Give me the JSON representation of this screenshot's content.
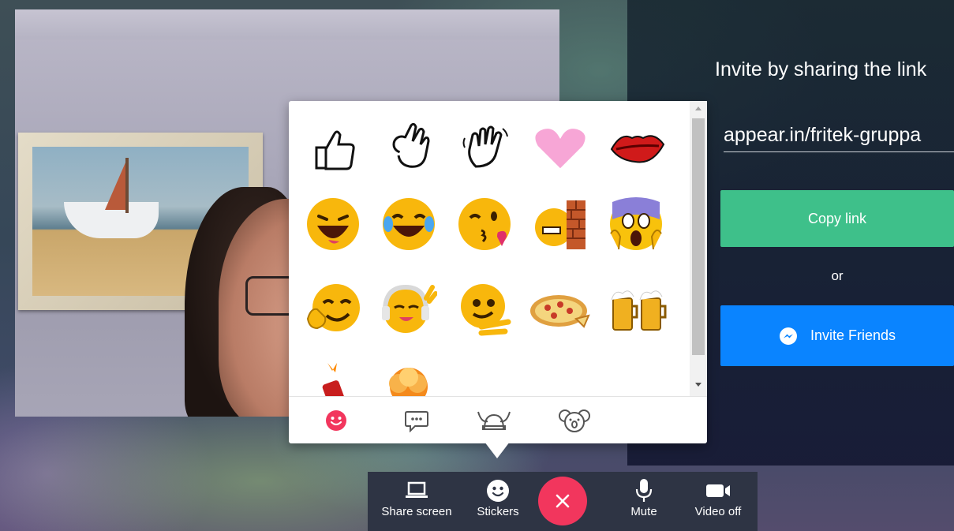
{
  "invite": {
    "title": "Invite by sharing the link",
    "link": "appear.in/fritek-gruppa",
    "copy_label": "Copy link",
    "or_label": "or",
    "friends_label": "Invite Friends"
  },
  "stickers": {
    "items": [
      "thumbs-up",
      "ok-hand",
      "waving-hand",
      "pink-heart",
      "red-lips",
      "laughing-face",
      "tears-of-joy-face",
      "kissing-wink-face",
      "face-hitting-wall",
      "screaming-face",
      "thumbs-up-smiley",
      "music-headphones-face",
      "pointing-fingers-face",
      "pizza",
      "beer-mugs-cheers",
      "dynamite",
      "explosion"
    ],
    "tabs": [
      "smiley-tab",
      "speech-bubble-tab",
      "viking-helmet-tab",
      "koala-tab"
    ],
    "active_tab": "smiley-tab"
  },
  "toolbar": {
    "share_screen": "Share screen",
    "stickers": "Stickers",
    "mute": "Mute",
    "video_off": "Video off"
  },
  "colors": {
    "copy_button": "#3ec08a",
    "invite_button": "#0a84ff",
    "hangup": "#f2365d",
    "active_tab": "#f2365d",
    "toolbar_bg": "#2e3444"
  }
}
